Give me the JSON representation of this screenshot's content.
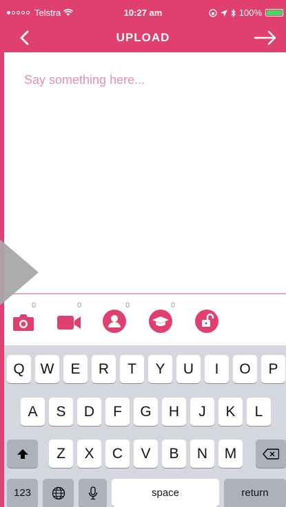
{
  "status_bar": {
    "carrier": "Telstra",
    "time": "10:27 am",
    "battery": "100%",
    "battery_level": 1.0
  },
  "nav": {
    "title": "UPLOAD"
  },
  "compose": {
    "placeholder": "Say something here..."
  },
  "attachments": {
    "photo_count": "0",
    "video_count": "0",
    "people_count": "0",
    "education_count": "0"
  },
  "keyboard": {
    "row1": [
      "Q",
      "W",
      "E",
      "R",
      "T",
      "Y",
      "U",
      "I",
      "O",
      "P"
    ],
    "row2": [
      "A",
      "S",
      "D",
      "F",
      "G",
      "H",
      "J",
      "K",
      "L"
    ],
    "row3": [
      "Z",
      "X",
      "C",
      "V",
      "B",
      "N",
      "M"
    ],
    "numbers_label": "123",
    "space_label": "space",
    "return_label": "return"
  },
  "colors": {
    "accent": "#e0406f",
    "placeholder": "#e68fb0",
    "keyboard_bg": "#d4d7de"
  }
}
